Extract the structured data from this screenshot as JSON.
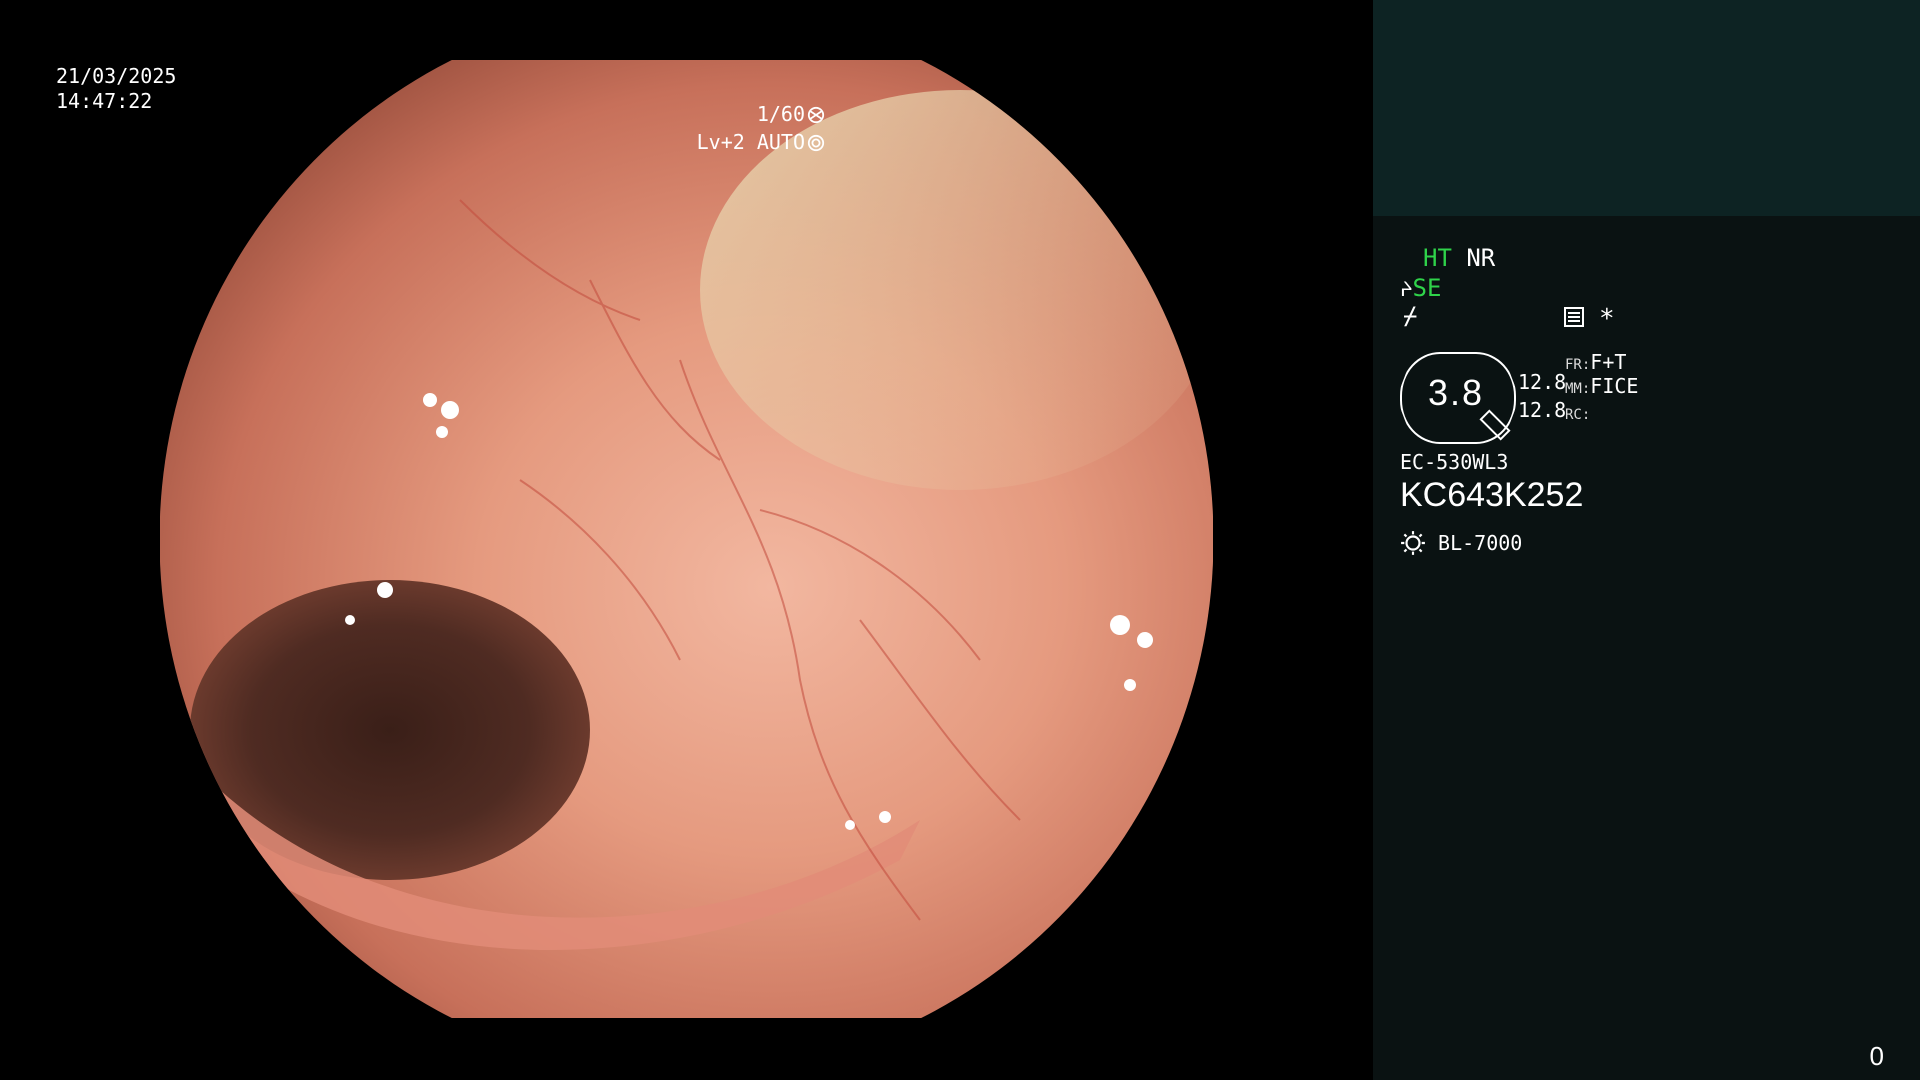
{
  "overlay": {
    "date": "21/03/2025",
    "time": "14:47:22",
    "shutter": "1/60",
    "level": "Lv+2",
    "mode": "AUTO"
  },
  "side": {
    "ht": "HT",
    "nr": "NR",
    "se": "SE",
    "asterisk": "*",
    "magnification": "3.8",
    "dist1": "12.8",
    "dist2": "12.8",
    "fr_label": "FR:",
    "fr_value": "F+T",
    "mm_label": "MM:",
    "mm_value": "FICE",
    "rc_label": "RC:",
    "scope_model": "EC-530WL3",
    "serial": "KC643K252",
    "light_source": "BL-7000",
    "counter": "0"
  },
  "colors": {
    "accent_green": "#2fd34a",
    "panel_top": "#0d2323",
    "panel": "#0a1212"
  }
}
